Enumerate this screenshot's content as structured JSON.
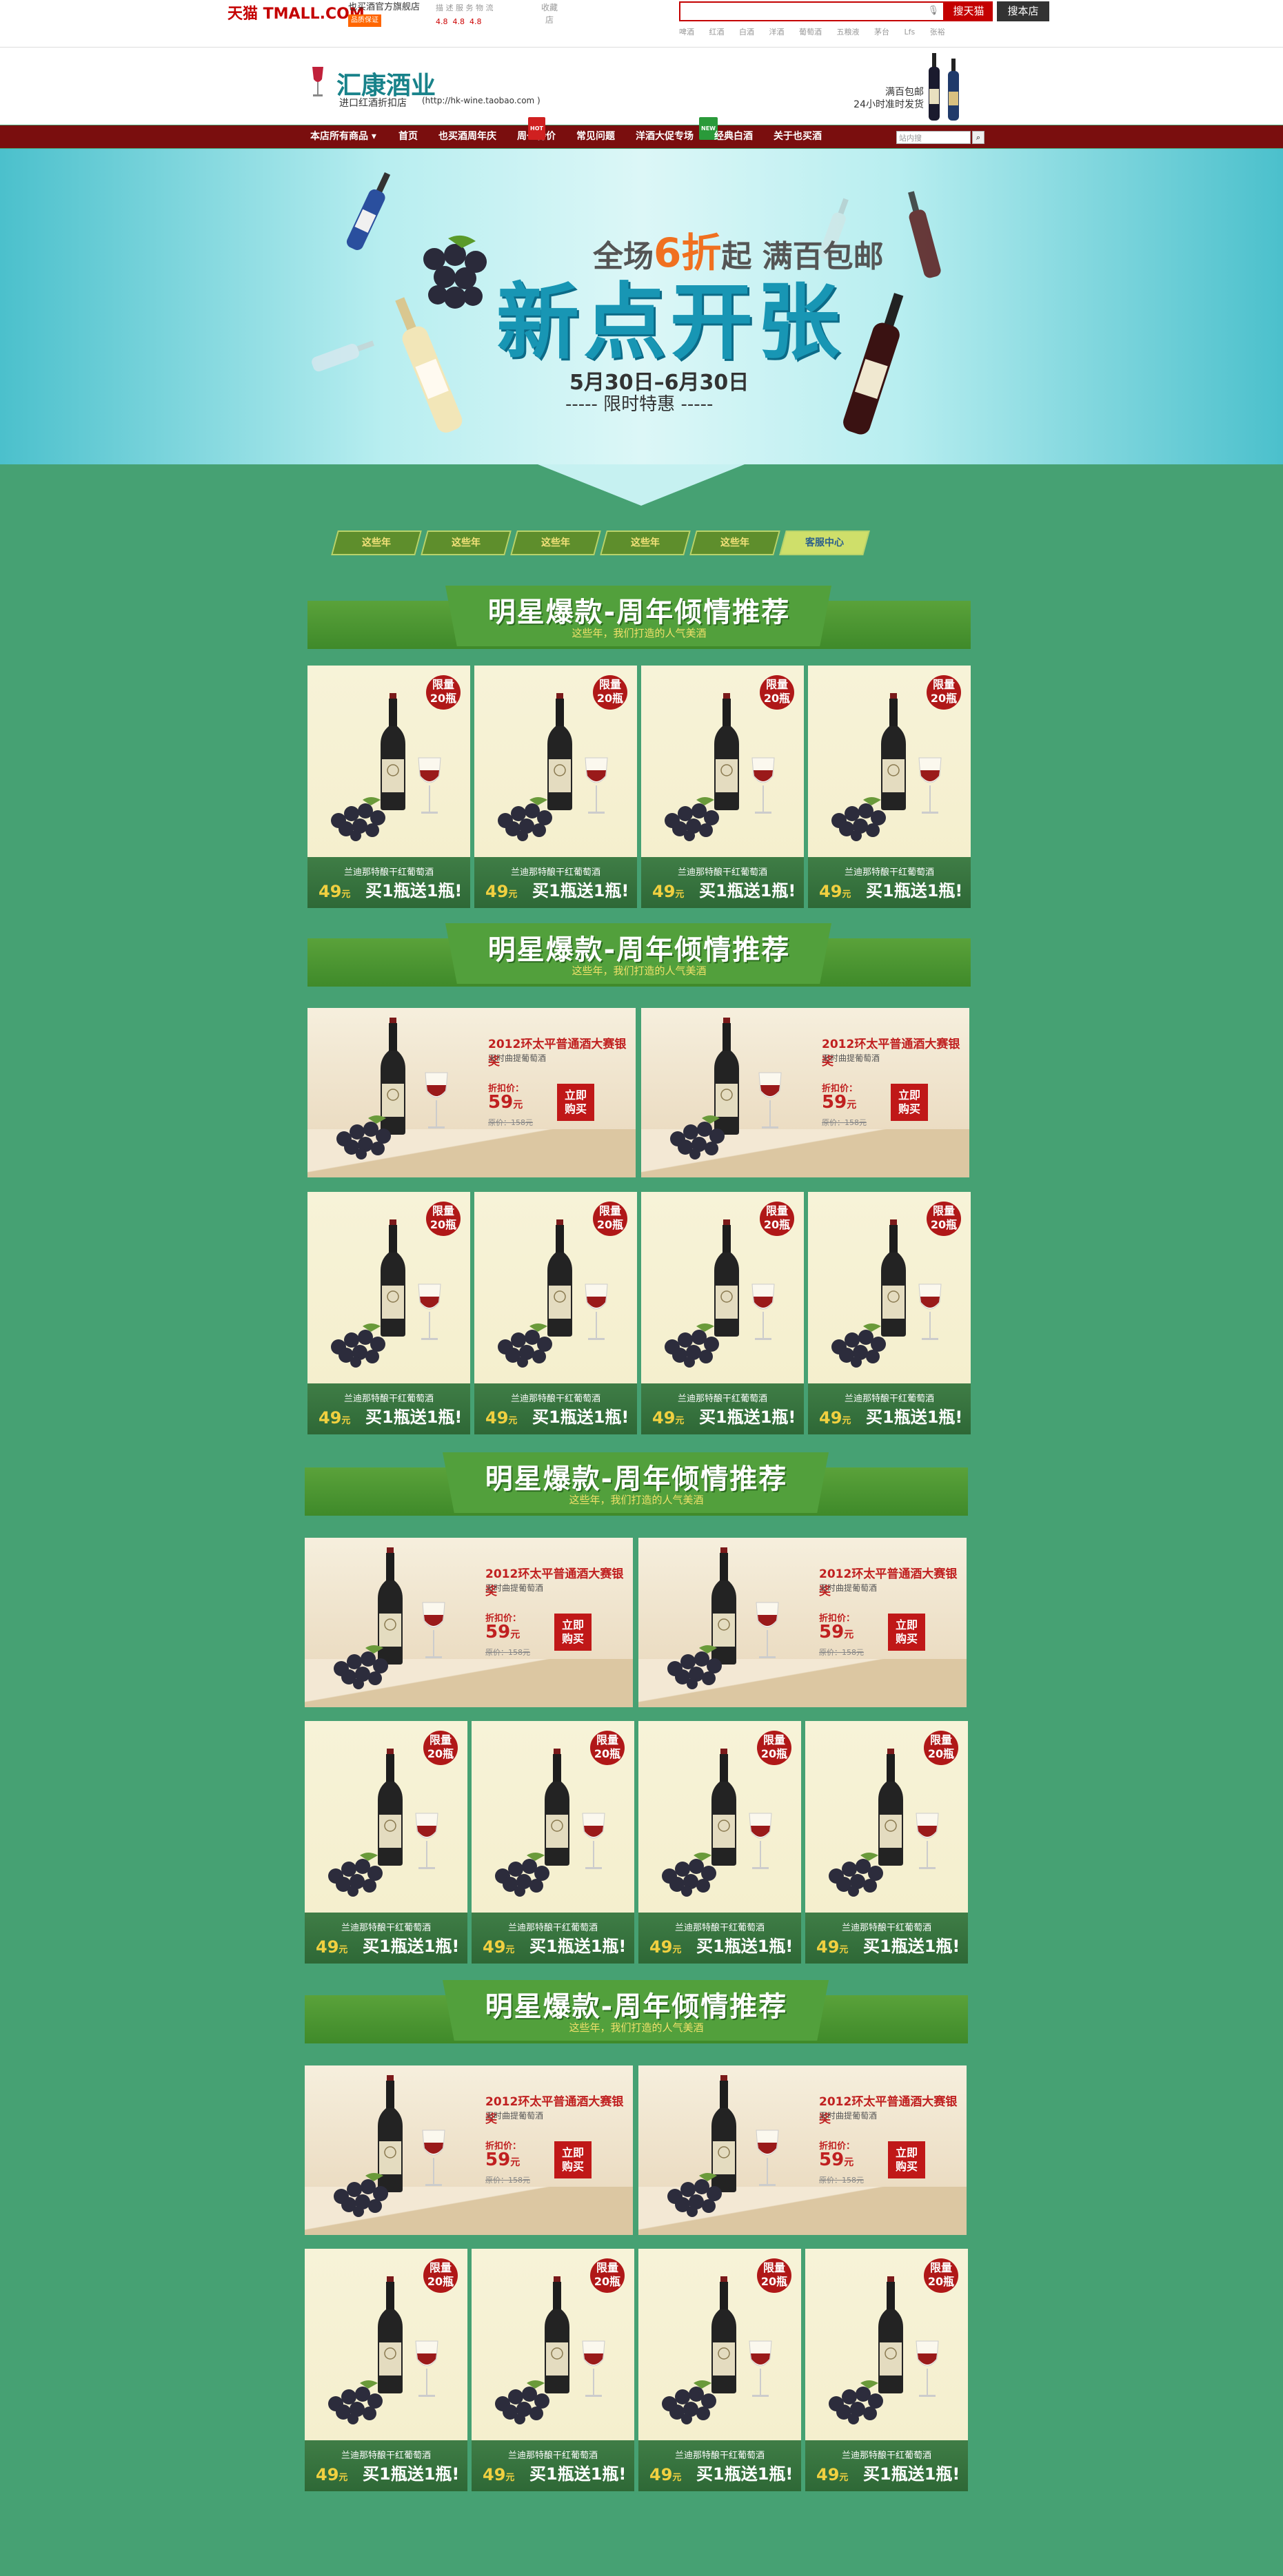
{
  "topbar": {
    "logo": "天猫 TMALL.COM",
    "store_title": "也买酒官方旗舰店",
    "store_badge": "品质保证",
    "rating_label": "描 述 服 务 物 流",
    "ratings": [
      "4.8",
      "4.8",
      "4.8"
    ],
    "collect_label": "收藏",
    "collect_sub": "店",
    "search_placeholder": "",
    "btn_tmall": "搜天猫",
    "btn_store": "搜本店",
    "hotwords": [
      "啤酒",
      "红酒",
      "白酒",
      "洋酒",
      "葡萄酒",
      "五粮液",
      "茅台",
      "Lfs",
      "张裕"
    ]
  },
  "shop": {
    "name": "汇康酒业",
    "subtitle": "进口红酒折扣店",
    "url": "(http://hk-wine.taobao.com )",
    "shipping_line1": "满百包邮",
    "shipping_line2": "24小时准时发货"
  },
  "nav": {
    "items": [
      {
        "label": "本店所有商品 ▾",
        "tag": ""
      },
      {
        "label": "首页",
        "tag": ""
      },
      {
        "label": "也买酒周年庆",
        "tag": ""
      },
      {
        "label": "周一特价",
        "tag": "HOT"
      },
      {
        "label": "常见问题",
        "tag": ""
      },
      {
        "label": "洋酒大促专场",
        "tag": "NEW"
      },
      {
        "label": "经典白酒",
        "tag": ""
      },
      {
        "label": "关于也买酒",
        "tag": ""
      }
    ],
    "search_placeholder": "站内搜",
    "search_icon": "magnifier-icon"
  },
  "banner": {
    "promo_prefix": "全场",
    "promo_highlight": "6折",
    "promo_suffix": "起 满百包邮",
    "headline": "新点开张",
    "dates": "5月30日–6月30日",
    "dates_sub": "----- 限时特惠 -----"
  },
  "ribbon": {
    "tabs": [
      "这些年",
      "这些年",
      "这些年",
      "这些年",
      "这些年"
    ],
    "service_label": "客服中心"
  },
  "sections": [
    {
      "title": "明星爆款-周年倾情推荐",
      "subtitle": "这些年，我们打造的人气美酒"
    },
    {
      "title": "明星爆款-周年倾情推荐",
      "subtitle": "这些年，我们打造的人气美酒"
    },
    {
      "title": "明星爆款-周年倾情推荐",
      "subtitle": "这些年，我们打造的人气美酒"
    },
    {
      "title": "明星爆款-周年倾情推荐",
      "subtitle": "这些年，我们打造的人气美酒"
    }
  ],
  "product": {
    "flag_line1": "限量",
    "flag_line2": "20瓶",
    "name": "兰迪那特酿干红葡萄酒",
    "price": "49",
    "price_unit": "元",
    "deal": "买1瓶送1瓶!"
  },
  "wide_product": {
    "award": "2012环太平普通酒大赛银奖",
    "kind": "天时曲提葡萄酒",
    "price_label": "折扣价：",
    "price": "59",
    "price_unit": "元",
    "orig": "原价：158元",
    "buy_line1": "立即",
    "buy_line2": "购买"
  },
  "colors": {
    "page_bg": "#46a173",
    "nav_bg": "#7a0e0e",
    "tmall_red": "#c40000",
    "accent_yellow": "#f0d040",
    "flag_red": "#b01818"
  }
}
